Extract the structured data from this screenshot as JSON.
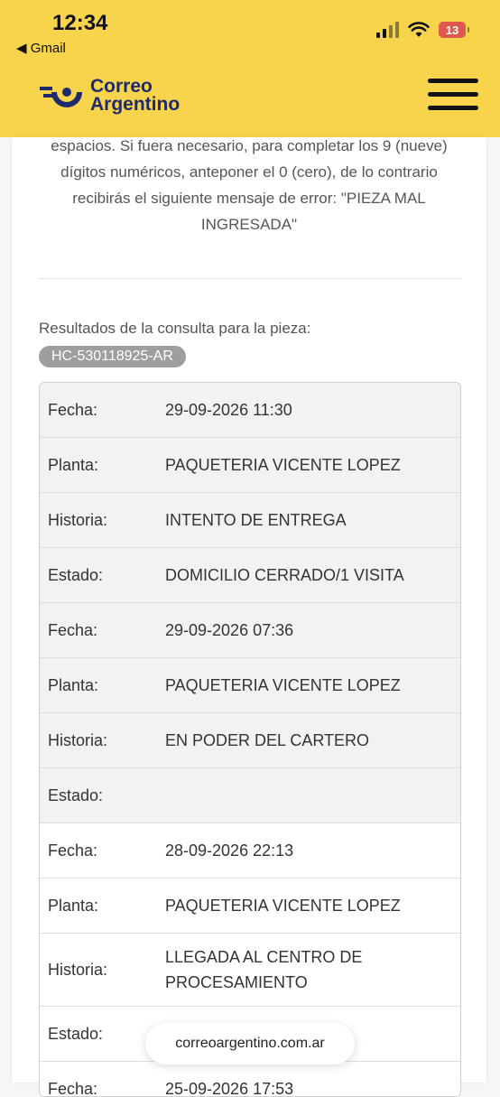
{
  "status_bar": {
    "time": "12:34",
    "back_label": "◀ Gmail",
    "battery": "13"
  },
  "header": {
    "logo_line1": "Correo",
    "logo_line2": "Argentino"
  },
  "intro_text": "espacios. Si fuera necesario, para completar los 9 (nueve) dígitos numéricos, anteponer el 0 (cero), de lo contrario recibirás el siguiente mensaje de error: \"PIEZA MAL INGRESADA\"",
  "results": {
    "label": "Resultados de la consulta para la pieza:",
    "piece_id": "HC-530118925-AR"
  },
  "rows": [
    {
      "key": "Fecha:",
      "value": "29-09-2026 11:30"
    },
    {
      "key": "Planta:",
      "value": "PAQUETERIA VICENTE LOPEZ"
    },
    {
      "key": "Historia:",
      "value": "INTENTO DE ENTREGA"
    },
    {
      "key": "Estado:",
      "value": "DOMICILIO CERRADO/1 VISITA"
    },
    {
      "key": "Fecha:",
      "value": "29-09-2026 07:36"
    },
    {
      "key": "Planta:",
      "value": "PAQUETERIA VICENTE LOPEZ"
    },
    {
      "key": "Historia:",
      "value": "EN PODER DEL CARTERO"
    },
    {
      "key": "Estado:",
      "value": ""
    },
    {
      "key": "Fecha:",
      "value": "28-09-2026 22:13"
    },
    {
      "key": "Planta:",
      "value": "PAQUETERIA VICENTE LOPEZ"
    },
    {
      "key": "Historia:",
      "value": "LLEGADA AL CENTRO DE PROCESAMIENTO"
    },
    {
      "key": "Estado:",
      "value": ""
    },
    {
      "key": "Fecha:",
      "value": "25-09-2026 17:53"
    }
  ],
  "browser": {
    "url": "correoargentino.com.ar"
  },
  "colors": {
    "header_yellow": "#f7d44c",
    "logo_navy": "#1f2a6e",
    "badge_gray": "#9e9e9e"
  }
}
